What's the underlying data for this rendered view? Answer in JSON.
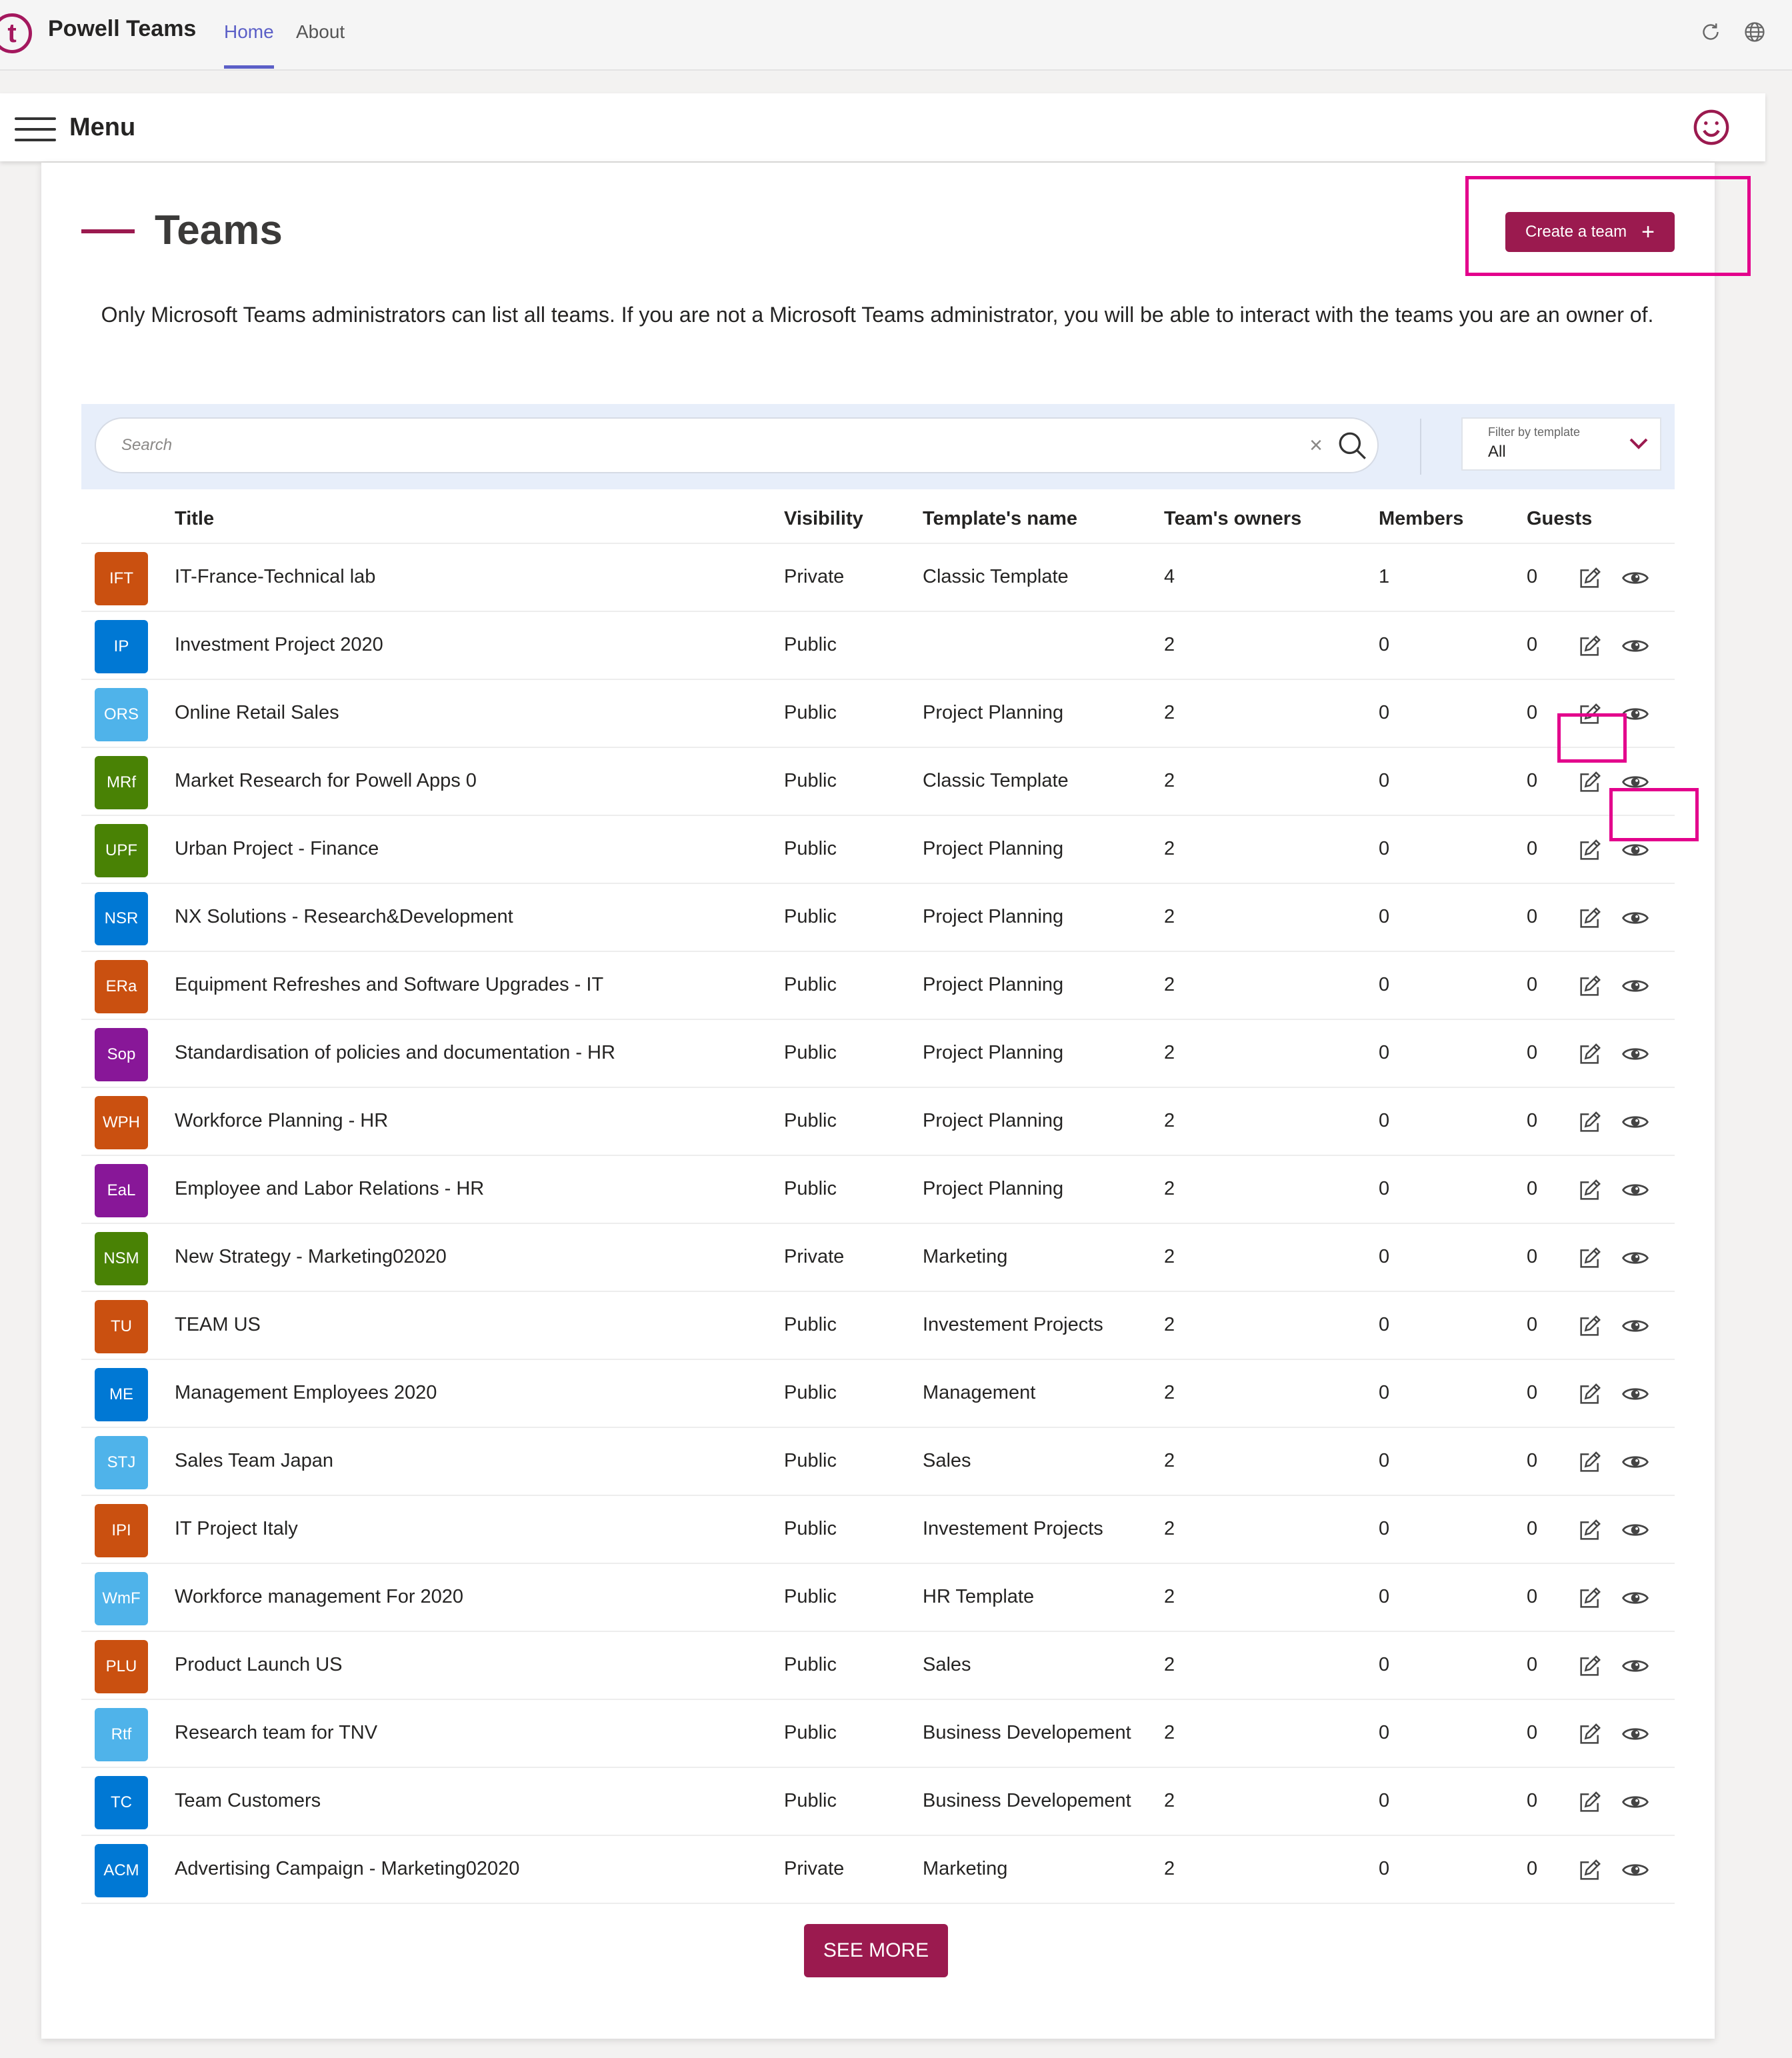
{
  "app": {
    "logo_letter": "t",
    "name": "Powell Teams",
    "tabs": [
      {
        "label": "Home",
        "active": true
      },
      {
        "label": "About",
        "active": false
      }
    ]
  },
  "menu": {
    "label": "Menu"
  },
  "page": {
    "title": "Teams",
    "create_button": "Create a team",
    "description": "Only Microsoft Teams administrators can list all teams. If you are not a Microsoft Teams administrator, you will be able to interact with the teams you are an owner of."
  },
  "search": {
    "placeholder": "Search",
    "value": "",
    "filter_label": "Filter by template",
    "filter_value": "All"
  },
  "table": {
    "columns": [
      "Title",
      "Visibility",
      "Template's name",
      "Team's owners",
      "Members",
      "Guests"
    ],
    "rows": [
      {
        "initials": "IFT",
        "color": "#ca5010",
        "title": "IT-France-Technical lab",
        "visibility": "Private",
        "template": "Classic Template",
        "owners": "4",
        "members": "1",
        "guests": "0"
      },
      {
        "initials": "IP",
        "color": "#0078d4",
        "title": "Investment Project 2020",
        "visibility": "Public",
        "template": "",
        "owners": "2",
        "members": "0",
        "guests": "0"
      },
      {
        "initials": "ORS",
        "color": "#4fb3ea",
        "title": "Online Retail Sales",
        "visibility": "Public",
        "template": "Project Planning",
        "owners": "2",
        "members": "0",
        "guests": "0"
      },
      {
        "initials": "MRf",
        "color": "#498205",
        "title": "Market Research for Powell Apps 0",
        "visibility": "Public",
        "template": "Classic Template",
        "owners": "2",
        "members": "0",
        "guests": "0"
      },
      {
        "initials": "UPF",
        "color": "#498205",
        "title": "Urban Project - Finance",
        "visibility": "Public",
        "template": "Project Planning",
        "owners": "2",
        "members": "0",
        "guests": "0"
      },
      {
        "initials": "NSR",
        "color": "#0078d4",
        "title": "NX Solutions - Research&Development",
        "visibility": "Public",
        "template": "Project Planning",
        "owners": "2",
        "members": "0",
        "guests": "0"
      },
      {
        "initials": "ERa",
        "color": "#ca5010",
        "title": "Equipment Refreshes and Software Upgrades - IT",
        "visibility": "Public",
        "template": "Project Planning",
        "owners": "2",
        "members": "0",
        "guests": "0"
      },
      {
        "initials": "Sop",
        "color": "#881798",
        "title": "Standardisation of policies and documentation - HR",
        "visibility": "Public",
        "template": "Project Planning",
        "owners": "2",
        "members": "0",
        "guests": "0"
      },
      {
        "initials": "WPH",
        "color": "#ca5010",
        "title": "Workforce Planning - HR",
        "visibility": "Public",
        "template": "Project Planning",
        "owners": "2",
        "members": "0",
        "guests": "0"
      },
      {
        "initials": "EaL",
        "color": "#881798",
        "title": "Employee and Labor Relations - HR",
        "visibility": "Public",
        "template": "Project Planning",
        "owners": "2",
        "members": "0",
        "guests": "0"
      },
      {
        "initials": "NSM",
        "color": "#498205",
        "title": "New Strategy - Marketing02020",
        "visibility": "Private",
        "template": "Marketing",
        "owners": "2",
        "members": "0",
        "guests": "0"
      },
      {
        "initials": "TU",
        "color": "#ca5010",
        "title": "TEAM US",
        "visibility": "Public",
        "template": "Investement Projects",
        "owners": "2",
        "members": "0",
        "guests": "0"
      },
      {
        "initials": "ME",
        "color": "#0078d4",
        "title": "Management Employees 2020",
        "visibility": "Public",
        "template": "Management",
        "owners": "2",
        "members": "0",
        "guests": "0"
      },
      {
        "initials": "STJ",
        "color": "#4fb3ea",
        "title": "Sales Team Japan",
        "visibility": "Public",
        "template": "Sales",
        "owners": "2",
        "members": "0",
        "guests": "0"
      },
      {
        "initials": "IPI",
        "color": "#ca5010",
        "title": "IT Project Italy",
        "visibility": "Public",
        "template": "Investement Projects",
        "owners": "2",
        "members": "0",
        "guests": "0"
      },
      {
        "initials": "WmF",
        "color": "#4fb3ea",
        "title": "Workforce management For 2020",
        "visibility": "Public",
        "template": "HR Template",
        "owners": "2",
        "members": "0",
        "guests": "0"
      },
      {
        "initials": "PLU",
        "color": "#ca5010",
        "title": "Product Launch US",
        "visibility": "Public",
        "template": "Sales",
        "owners": "2",
        "members": "0",
        "guests": "0"
      },
      {
        "initials": "Rtf",
        "color": "#4fb3ea",
        "title": "Research team for TNV",
        "visibility": "Public",
        "template": "Business Developement",
        "owners": "2",
        "members": "0",
        "guests": "0"
      },
      {
        "initials": "TC",
        "color": "#0078d4",
        "title": "Team Customers",
        "visibility": "Public",
        "template": "Business Developement",
        "owners": "2",
        "members": "0",
        "guests": "0"
      },
      {
        "initials": "ACM",
        "color": "#0078d4",
        "title": "Advertising Campaign - Marketing02020",
        "visibility": "Private",
        "template": "Marketing",
        "owners": "2",
        "members": "0",
        "guests": "0"
      }
    ]
  },
  "see_more": "SEE MORE",
  "colors": {
    "accent": "#9b1a4f",
    "highlight": "#e3008c",
    "nav_active": "#5b5fc7"
  },
  "icons": {
    "row_edit": "edit-icon",
    "row_view": "eye-icon",
    "search": "search-icon",
    "clear": "close-icon",
    "filter": "chevron-down-icon",
    "refresh": "refresh-icon",
    "globe": "globe-icon",
    "user": "smiley-icon"
  }
}
